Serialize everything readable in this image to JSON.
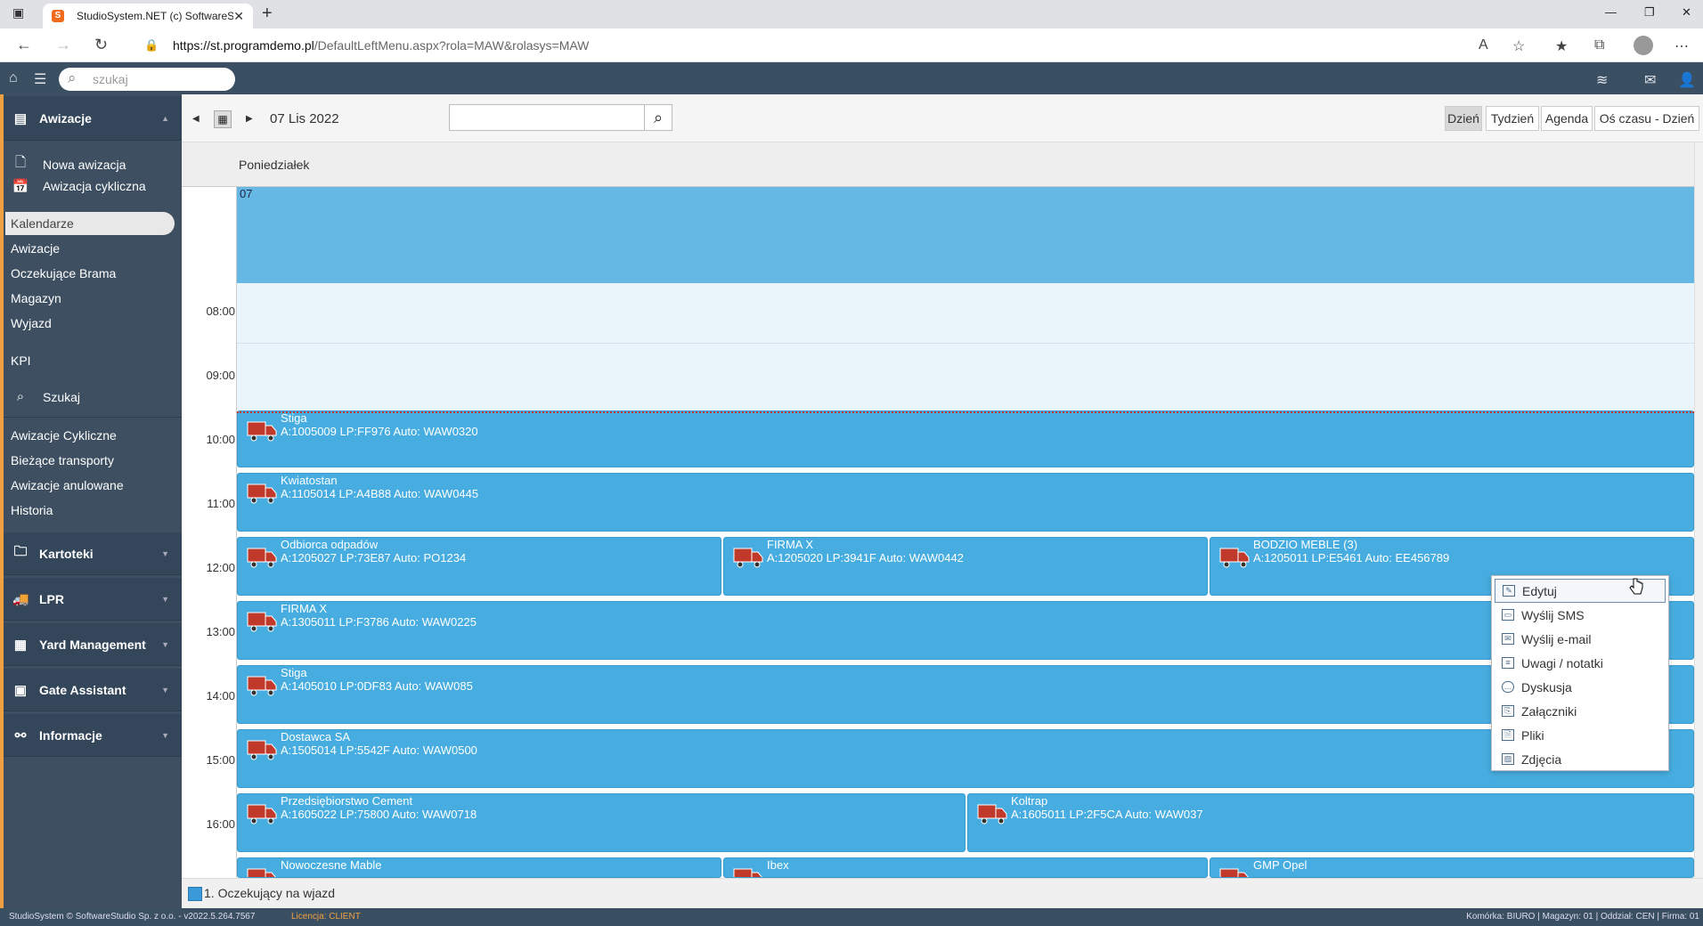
{
  "browser": {
    "tab_title": "StudioSystem.NET (c) SoftwareSt",
    "url_host": "https://st.programdemo.pl",
    "url_path": "/DefaultLeftMenu.aspx?rola=MAW&rolasys=MAW"
  },
  "header": {
    "search_placeholder": "szukaj"
  },
  "sidebar": {
    "awizacje_title": "Awizacje",
    "actions": [
      "Nowa awizacja",
      "Awizacja cykliczna"
    ],
    "active": "Kalendarze",
    "items1": [
      "Awizacje",
      "Oczekujące Brama",
      "Magazyn",
      "Wyjazd"
    ],
    "kpi": "KPI",
    "szukaj": "Szukaj",
    "items2": [
      "Awizacje Cykliczne",
      "Bieżące transporty",
      "Awizacje anulowane",
      "Historia"
    ],
    "sections": [
      "Kartoteki",
      "LPR",
      "Yard Management",
      "Gate Assistant",
      "Informacje"
    ]
  },
  "calendar": {
    "date": "07 Lis 2022",
    "views": [
      "Dzień",
      "Tydzień",
      "Agenda",
      "Oś czasu - Dzień"
    ],
    "day_name": "Poniedziałek",
    "allday_label": "07",
    "hours": [
      "08:00",
      "09:00",
      "10:00",
      "11:00",
      "12:00",
      "13:00",
      "14:00",
      "15:00",
      "16:00"
    ],
    "events": [
      {
        "name": "Stiga",
        "detail": "A:1005009 LP:FF976 Auto: WAW0320"
      },
      {
        "name": "Kwiatostan",
        "detail": "A:1105014 LP:A4B88 Auto: WAW0445"
      },
      {
        "name": "Odbiorca odpadów",
        "detail": "A:1205027 LP:73E87 Auto: PO1234"
      },
      {
        "name": "FIRMA X",
        "detail": "A:1205020 LP:3941F Auto: WAW0442"
      },
      {
        "name": "BODZIO MEBLE (3)",
        "detail": "A:1205011 LP:E5461 Auto: EE456789"
      },
      {
        "name": "FIRMA X",
        "detail": "A:1305011 LP:F3786 Auto: WAW0225"
      },
      {
        "name": "Stiga",
        "detail": "A:1405010 LP:0DF83 Auto: WAW085"
      },
      {
        "name": "Dostawca SA",
        "detail": "A:1505014 LP:5542F Auto: WAW0500"
      },
      {
        "name": "Przedsiębiorstwo Cement",
        "detail": "A:1605022 LP:75800 Auto: WAW0718"
      },
      {
        "name": "Koltrap",
        "detail": "A:1605011 LP:2F5CA Auto: WAW037"
      },
      {
        "name": "Nowoczesne Mable",
        "detail": ""
      },
      {
        "name": "Ibex",
        "detail": ""
      },
      {
        "name": "GMP Opel",
        "detail": ""
      }
    ]
  },
  "context_menu": [
    "Edytuj",
    "Wyślij SMS",
    "Wyślij e-mail",
    "Uwagi / notatki",
    "Dyskusja",
    "Załączniki",
    "Pliki",
    "Zdjęcia"
  ],
  "legend": "1. Oczekujący na wjazd",
  "status": {
    "left": "StudioSystem © SoftwareStudio Sp. z o.o. - v2022.5.264.7567",
    "license": "Licencja: CLIENT",
    "right": "Komórka: BIURO | Magazyn: 01 | Oddział: CEN | Firma: 01"
  }
}
